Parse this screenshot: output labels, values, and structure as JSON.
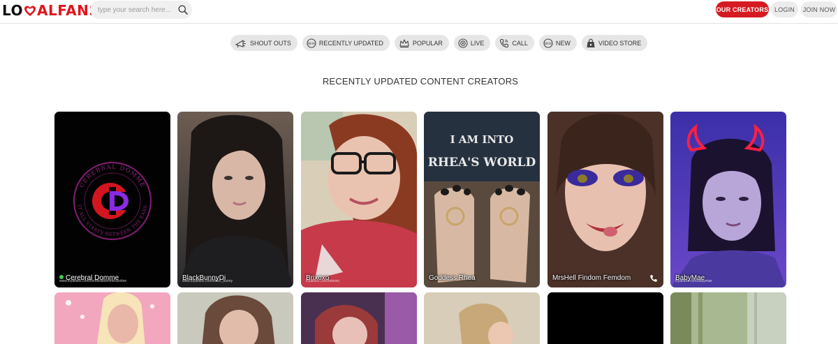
{
  "header": {
    "logo": {
      "left": "LO",
      "right": "ALFANS"
    },
    "search": {
      "placeholder": "type your search here..."
    },
    "buttons": {
      "creators": "OUR CREATORS",
      "login": "LOGIN",
      "join": "JOIN NOW"
    }
  },
  "nav": [
    {
      "label": "SHOUT OUTS",
      "icon": "megaphone-icon"
    },
    {
      "label": "RECENTLY UPDATED",
      "icon": "new-badge-icon"
    },
    {
      "label": "POPULAR",
      "icon": "crown-icon"
    },
    {
      "label": "LIVE",
      "icon": "live-icon"
    },
    {
      "label": "CALL",
      "icon": "phone-icon"
    },
    {
      "label": "NEW",
      "icon": "new-badge-icon"
    },
    {
      "label": "VIDEO STORE",
      "icon": "shopping-bag-icon"
    }
  ],
  "section_title": "RECENTLY UPDATED CONTENT CREATORS",
  "creators": [
    {
      "name": "Cerebral Domme",
      "handle": "www.loyalfans.com/cerebraldommecaroline",
      "online": true,
      "logo_text_top": "CEREBRAL DOMME",
      "logo_text_bottom": "IT ALL STARTS BETWEEN THE EARS"
    },
    {
      "name": "BlackBunnyDi",
      "handle": "www.loyalfans.com/black_bunny"
    },
    {
      "name": "Brixoxo",
      "handle": "loyalfans.com/brixoxo"
    },
    {
      "name": "Goddess Rhea",
      "handle": "",
      "shirt_text": "I AM INTO RHEA'S WORLD"
    },
    {
      "name": "MrsHell Findom Femdom",
      "handle": "",
      "call": true
    },
    {
      "name": "BabyMae",
      "handle": "loyalfans.com/babymae"
    }
  ],
  "colors": {
    "brand_red": "#d51a22",
    "pill_bg": "#e6e6e6",
    "online": "#3fca56"
  }
}
